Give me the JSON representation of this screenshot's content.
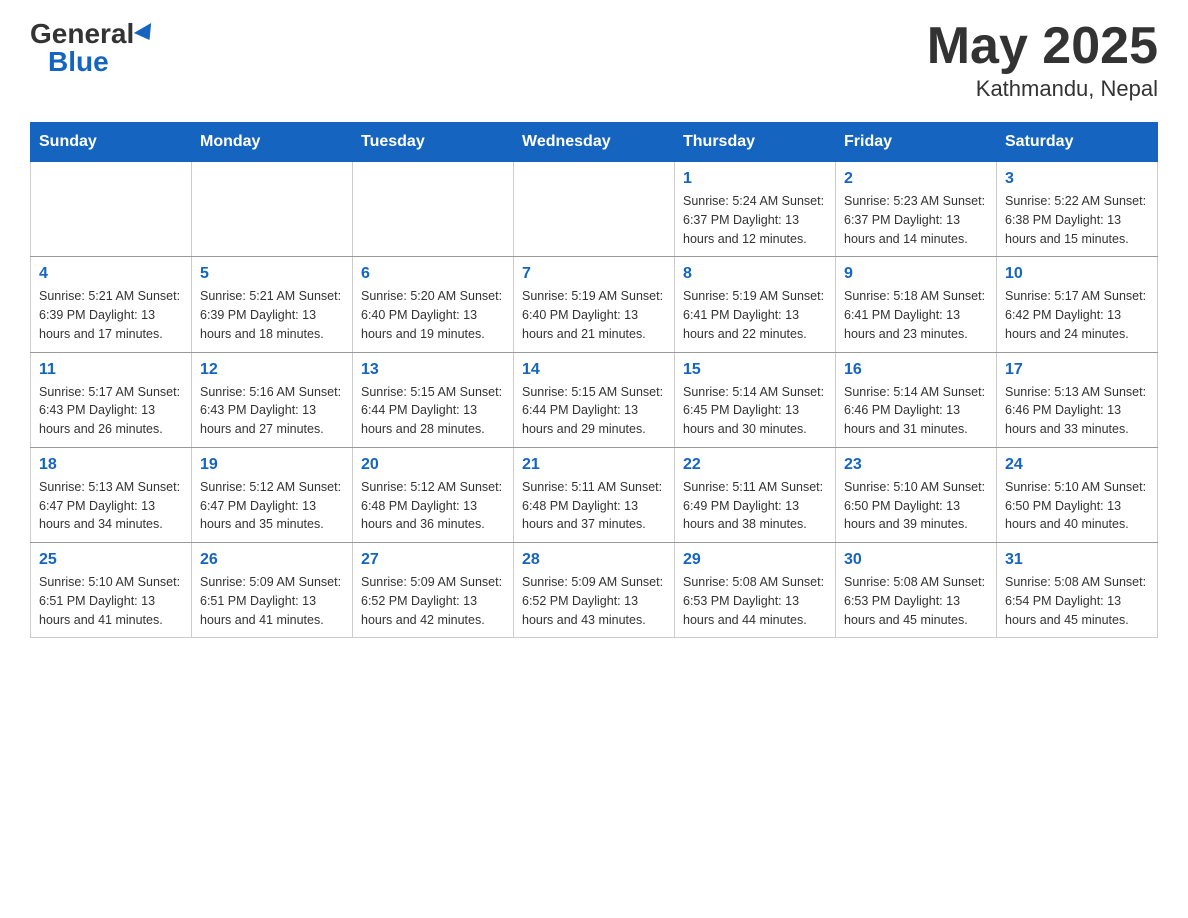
{
  "header": {
    "logo_general": "General",
    "logo_blue": "Blue",
    "title": "May 2025",
    "location": "Kathmandu, Nepal"
  },
  "days_of_week": [
    "Sunday",
    "Monday",
    "Tuesday",
    "Wednesday",
    "Thursday",
    "Friday",
    "Saturday"
  ],
  "weeks": [
    [
      {
        "day": "",
        "info": ""
      },
      {
        "day": "",
        "info": ""
      },
      {
        "day": "",
        "info": ""
      },
      {
        "day": "",
        "info": ""
      },
      {
        "day": "1",
        "info": "Sunrise: 5:24 AM\nSunset: 6:37 PM\nDaylight: 13 hours and 12 minutes."
      },
      {
        "day": "2",
        "info": "Sunrise: 5:23 AM\nSunset: 6:37 PM\nDaylight: 13 hours and 14 minutes."
      },
      {
        "day": "3",
        "info": "Sunrise: 5:22 AM\nSunset: 6:38 PM\nDaylight: 13 hours and 15 minutes."
      }
    ],
    [
      {
        "day": "4",
        "info": "Sunrise: 5:21 AM\nSunset: 6:39 PM\nDaylight: 13 hours and 17 minutes."
      },
      {
        "day": "5",
        "info": "Sunrise: 5:21 AM\nSunset: 6:39 PM\nDaylight: 13 hours and 18 minutes."
      },
      {
        "day": "6",
        "info": "Sunrise: 5:20 AM\nSunset: 6:40 PM\nDaylight: 13 hours and 19 minutes."
      },
      {
        "day": "7",
        "info": "Sunrise: 5:19 AM\nSunset: 6:40 PM\nDaylight: 13 hours and 21 minutes."
      },
      {
        "day": "8",
        "info": "Sunrise: 5:19 AM\nSunset: 6:41 PM\nDaylight: 13 hours and 22 minutes."
      },
      {
        "day": "9",
        "info": "Sunrise: 5:18 AM\nSunset: 6:41 PM\nDaylight: 13 hours and 23 minutes."
      },
      {
        "day": "10",
        "info": "Sunrise: 5:17 AM\nSunset: 6:42 PM\nDaylight: 13 hours and 24 minutes."
      }
    ],
    [
      {
        "day": "11",
        "info": "Sunrise: 5:17 AM\nSunset: 6:43 PM\nDaylight: 13 hours and 26 minutes."
      },
      {
        "day": "12",
        "info": "Sunrise: 5:16 AM\nSunset: 6:43 PM\nDaylight: 13 hours and 27 minutes."
      },
      {
        "day": "13",
        "info": "Sunrise: 5:15 AM\nSunset: 6:44 PM\nDaylight: 13 hours and 28 minutes."
      },
      {
        "day": "14",
        "info": "Sunrise: 5:15 AM\nSunset: 6:44 PM\nDaylight: 13 hours and 29 minutes."
      },
      {
        "day": "15",
        "info": "Sunrise: 5:14 AM\nSunset: 6:45 PM\nDaylight: 13 hours and 30 minutes."
      },
      {
        "day": "16",
        "info": "Sunrise: 5:14 AM\nSunset: 6:46 PM\nDaylight: 13 hours and 31 minutes."
      },
      {
        "day": "17",
        "info": "Sunrise: 5:13 AM\nSunset: 6:46 PM\nDaylight: 13 hours and 33 minutes."
      }
    ],
    [
      {
        "day": "18",
        "info": "Sunrise: 5:13 AM\nSunset: 6:47 PM\nDaylight: 13 hours and 34 minutes."
      },
      {
        "day": "19",
        "info": "Sunrise: 5:12 AM\nSunset: 6:47 PM\nDaylight: 13 hours and 35 minutes."
      },
      {
        "day": "20",
        "info": "Sunrise: 5:12 AM\nSunset: 6:48 PM\nDaylight: 13 hours and 36 minutes."
      },
      {
        "day": "21",
        "info": "Sunrise: 5:11 AM\nSunset: 6:48 PM\nDaylight: 13 hours and 37 minutes."
      },
      {
        "day": "22",
        "info": "Sunrise: 5:11 AM\nSunset: 6:49 PM\nDaylight: 13 hours and 38 minutes."
      },
      {
        "day": "23",
        "info": "Sunrise: 5:10 AM\nSunset: 6:50 PM\nDaylight: 13 hours and 39 minutes."
      },
      {
        "day": "24",
        "info": "Sunrise: 5:10 AM\nSunset: 6:50 PM\nDaylight: 13 hours and 40 minutes."
      }
    ],
    [
      {
        "day": "25",
        "info": "Sunrise: 5:10 AM\nSunset: 6:51 PM\nDaylight: 13 hours and 41 minutes."
      },
      {
        "day": "26",
        "info": "Sunrise: 5:09 AM\nSunset: 6:51 PM\nDaylight: 13 hours and 41 minutes."
      },
      {
        "day": "27",
        "info": "Sunrise: 5:09 AM\nSunset: 6:52 PM\nDaylight: 13 hours and 42 minutes."
      },
      {
        "day": "28",
        "info": "Sunrise: 5:09 AM\nSunset: 6:52 PM\nDaylight: 13 hours and 43 minutes."
      },
      {
        "day": "29",
        "info": "Sunrise: 5:08 AM\nSunset: 6:53 PM\nDaylight: 13 hours and 44 minutes."
      },
      {
        "day": "30",
        "info": "Sunrise: 5:08 AM\nSunset: 6:53 PM\nDaylight: 13 hours and 45 minutes."
      },
      {
        "day": "31",
        "info": "Sunrise: 5:08 AM\nSunset: 6:54 PM\nDaylight: 13 hours and 45 minutes."
      }
    ]
  ]
}
